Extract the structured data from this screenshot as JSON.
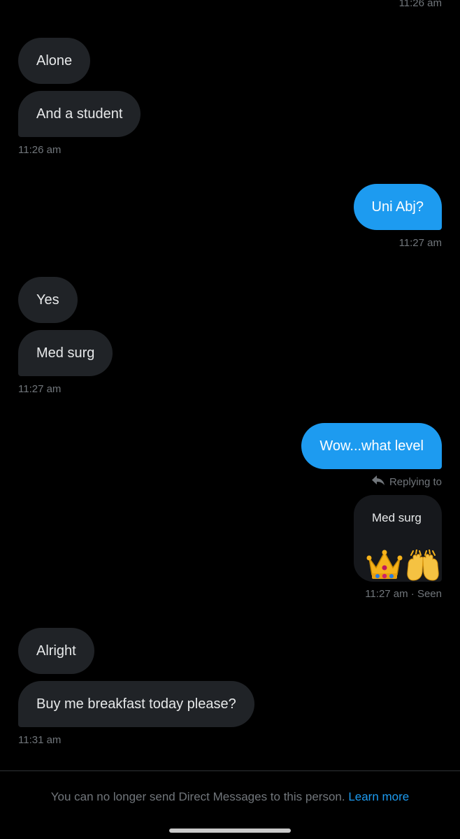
{
  "messages": {
    "top_timestamp": "11:26 am",
    "group1": {
      "bubbles": [
        "Alone",
        "And a student"
      ],
      "timestamp": "11:26 am"
    },
    "out1": {
      "text": "Uni Abj?",
      "timestamp": "11:27 am"
    },
    "group2": {
      "bubbles": [
        "Yes",
        "Med surg"
      ],
      "timestamp": "11:27 am"
    },
    "out2": {
      "text": "Wow...what level"
    },
    "reply": {
      "label": "Replying to",
      "quoted": "Med surg",
      "emoji": [
        "crown",
        "raising-hands"
      ],
      "timestamp": "11:27 am · Seen"
    },
    "group3": {
      "bubbles": [
        "Alright",
        "Buy me breakfast today please?"
      ],
      "timestamp": "11:31 am"
    }
  },
  "footer": {
    "notice": "You can no longer send Direct Messages to this person.",
    "learn_more": "Learn more"
  },
  "colors": {
    "background": "#000000",
    "incoming_bubble": "#202327",
    "outgoing_bubble": "#1d9bf0",
    "muted_text": "#71767b",
    "link": "#1d9bf0"
  }
}
